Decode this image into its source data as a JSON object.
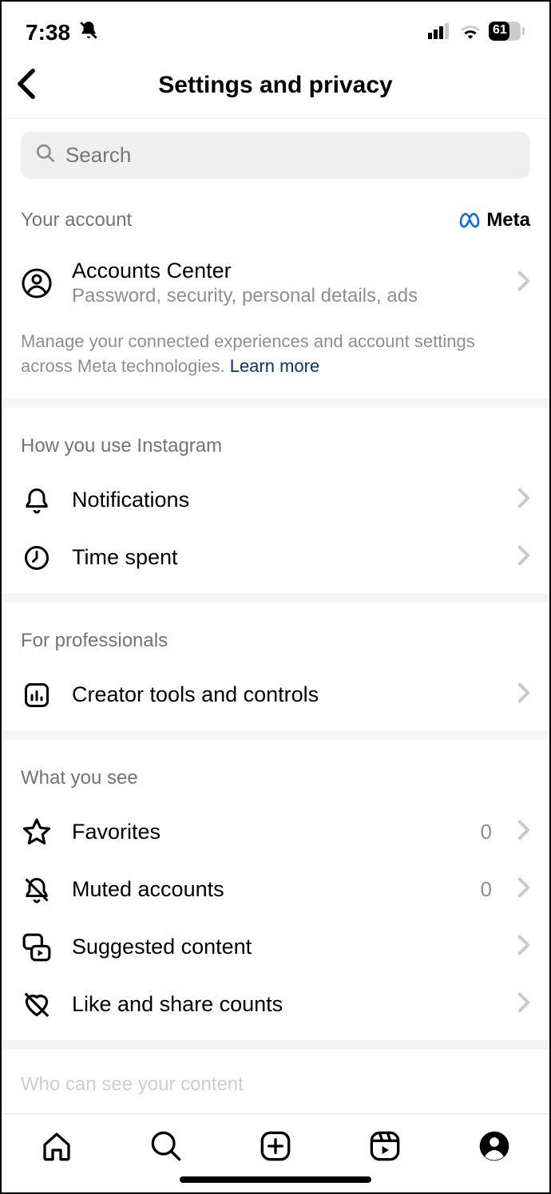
{
  "statusBar": {
    "time": "7:38",
    "battery": "61"
  },
  "header": {
    "title": "Settings and privacy"
  },
  "search": {
    "placeholder": "Search"
  },
  "accountSection": {
    "title": "Your account",
    "metaLabel": "Meta",
    "accountsCenter": {
      "title": "Accounts Center",
      "sub": "Password, security, personal details, ads"
    },
    "note": "Manage your connected experiences and account settings across Meta technologies. ",
    "noteLink": "Learn more"
  },
  "usageSection": {
    "title": "How you use Instagram",
    "notifications": "Notifications",
    "timeSpent": "Time spent"
  },
  "proSection": {
    "title": "For professionals",
    "creator": "Creator tools and controls"
  },
  "seeSection": {
    "title": "What you see",
    "favorites": {
      "label": "Favorites",
      "value": "0"
    },
    "muted": {
      "label": "Muted accounts",
      "value": "0"
    },
    "suggested": "Suggested content",
    "likeCounts": "Like and share counts"
  },
  "cutSection": {
    "title": "Who can see your content"
  }
}
